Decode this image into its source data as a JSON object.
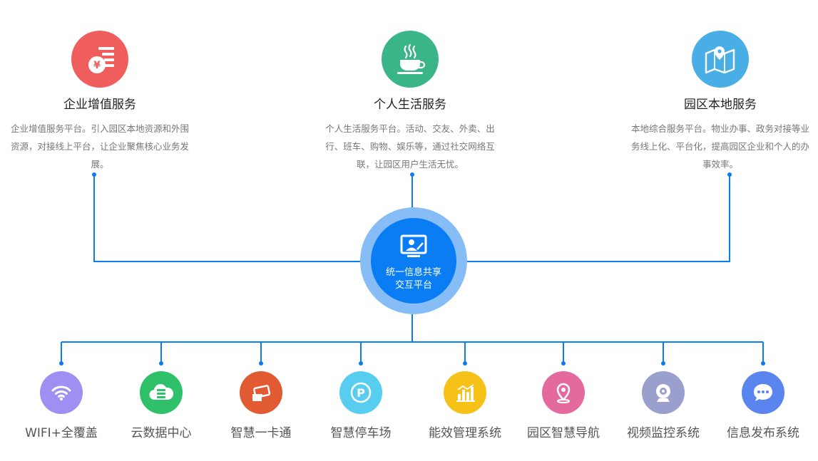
{
  "colors": {
    "line": "#0a7cf4",
    "hub_outer": "#86bdf7",
    "hub_inner": "#0a7cf4"
  },
  "hub": {
    "line1": "统一信息共享",
    "line2": "交互平台",
    "icon": "monitor-person-icon"
  },
  "services": [
    {
      "title": "企业增值服务",
      "desc": "企业增值服务平台。引入园区本地资源和外围资源，对接线上平台，让企业聚焦核心业务发展。",
      "color": "#f05d5d",
      "icon": "yen-list-icon"
    },
    {
      "title": "个人生活服务",
      "desc": "个人生活服务平台。活动、交友、外卖、出行、班车、购物、娱乐等，通过社交网络互联，让园区用户生活无忧。",
      "color": "#3ab588",
      "icon": "coffee-cup-icon"
    },
    {
      "title": "园区本地服务",
      "desc": "本地综合服务平台。物业办事、政务对接等业务线上化、平台化，提高园区企业和个人的办事效率。",
      "color": "#4aaee6",
      "icon": "map-pin-icon"
    }
  ],
  "systems": [
    {
      "label": "WIFI+全覆盖",
      "color": "#9e8ff2",
      "icon": "wifi-icon"
    },
    {
      "label": "云数据中心",
      "color": "#2fc169",
      "icon": "cloud-server-icon"
    },
    {
      "label": "智慧一卡通",
      "color": "#e25a32",
      "icon": "card-icon"
    },
    {
      "label": "智慧停车场",
      "color": "#57cdef",
      "icon": "parking-icon"
    },
    {
      "label": "能效管理系统",
      "color": "#f7c218",
      "icon": "bar-chart-icon"
    },
    {
      "label": "园区智慧导航",
      "color": "#e4699c",
      "icon": "location-pin-icon"
    },
    {
      "label": "视频监控系统",
      "color": "#9a9fce",
      "icon": "webcam-icon"
    },
    {
      "label": "信息发布系统",
      "color": "#5a84ee",
      "icon": "chat-bubble-icon"
    }
  ]
}
